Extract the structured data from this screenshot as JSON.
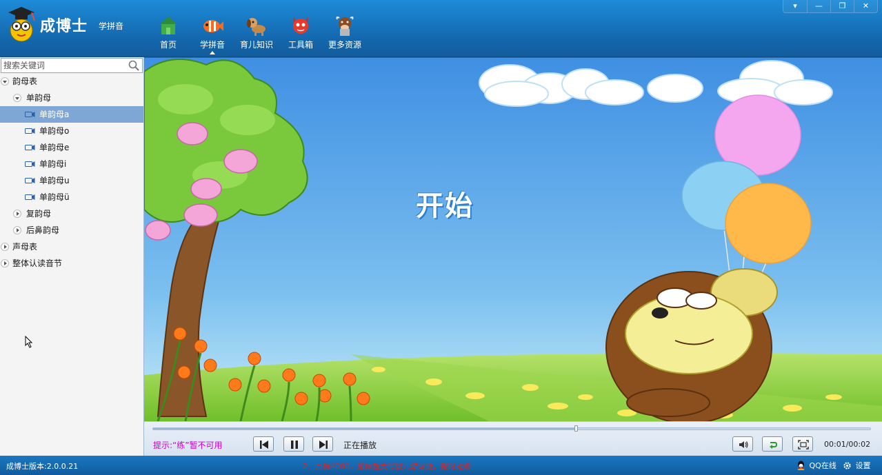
{
  "app": {
    "brand": "成博士",
    "brand_sub": "学拼音"
  },
  "nav": [
    {
      "label": "首页",
      "icon": "home-icon"
    },
    {
      "label": "学拼音",
      "icon": "fish-icon",
      "active": true
    },
    {
      "label": "育儿知识",
      "icon": "dog-icon"
    },
    {
      "label": "工具箱",
      "icon": "devil-icon"
    },
    {
      "label": "更多资源",
      "icon": "cow-icon"
    }
  ],
  "window_controls": [
    "▾",
    "—",
    "❐",
    "✕"
  ],
  "sidebar": {
    "search_placeholder": "搜索关键词",
    "tree": [
      {
        "label": "韵母表",
        "level": 0,
        "toggle": "open"
      },
      {
        "label": "单韵母",
        "level": 1,
        "toggle": "open"
      },
      {
        "label": "单韵母a",
        "level": 2,
        "video": true,
        "selected": true
      },
      {
        "label": "单韵母o",
        "level": 2,
        "video": true
      },
      {
        "label": "单韵母e",
        "level": 2,
        "video": true
      },
      {
        "label": "单韵母i",
        "level": 2,
        "video": true
      },
      {
        "label": "单韵母u",
        "level": 2,
        "video": true
      },
      {
        "label": "单韵母ü",
        "level": 2,
        "video": true
      },
      {
        "label": "复韵母",
        "level": 1,
        "toggle": "closed"
      },
      {
        "label": "后鼻韵母",
        "level": 1,
        "toggle": "closed"
      },
      {
        "label": "声母表",
        "level": 0,
        "toggle": "closed"
      },
      {
        "label": "整体认读音节",
        "level": 0,
        "toggle": "closed"
      }
    ]
  },
  "video": {
    "overlay_text": "开始"
  },
  "player": {
    "tip": "提示:“练”暂不可用",
    "status": "正在播放",
    "time": "00:01/00:02",
    "progress": 0.59
  },
  "status": {
    "version": "成博士版本:2.0.0.21",
    "ad": "2、月销4000，加厚超大号婴儿游泳池，限时抢购",
    "qq": "QQ在线",
    "settings": "设置"
  },
  "colors": {
    "accent": "#1673b8",
    "selected_row": "#7ea7d6",
    "tip": "#cc00cc",
    "ad": "#e02424"
  }
}
